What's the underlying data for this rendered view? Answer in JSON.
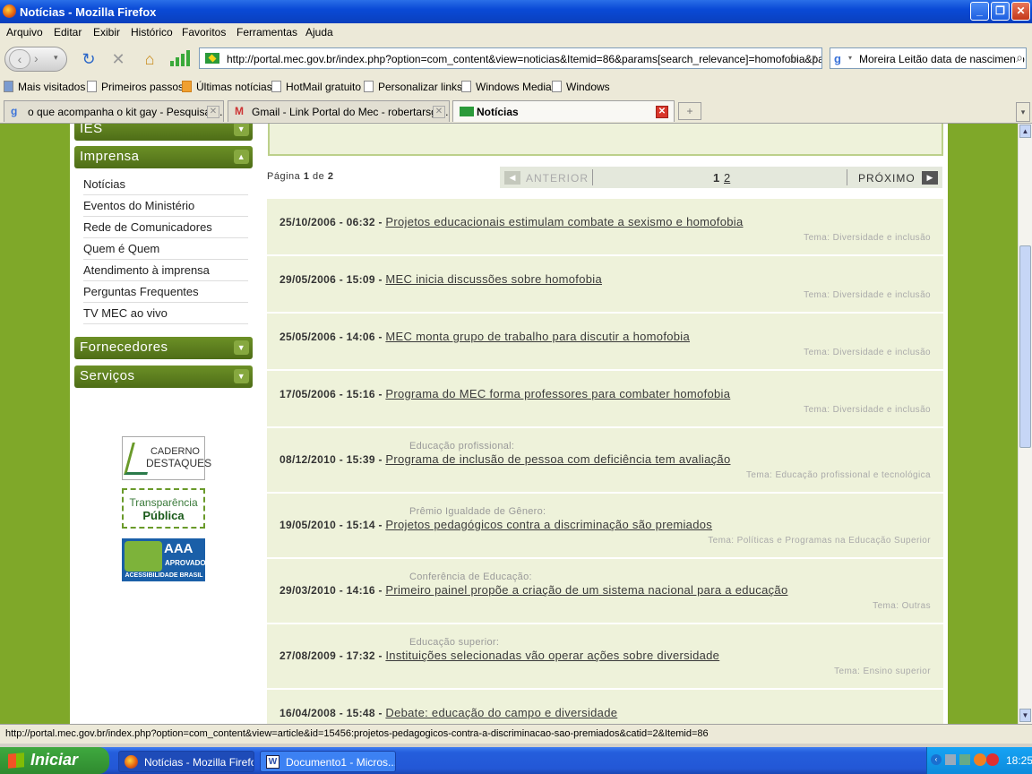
{
  "window": {
    "title": "Notícias - Mozilla Firefox"
  },
  "menu": [
    "Arquivo",
    "Editar",
    "Exibir",
    "Histórico",
    "Favoritos",
    "Ferramentas",
    "Ajuda"
  ],
  "nav": {
    "url": "http://portal.mec.gov.br/index.php?option=com_content&view=noticias&Itemid=86&params[search_relevance]=homofobia&par",
    "search": "Moreira Leitão data de nascimento"
  },
  "bookmarks": [
    "Mais visitados",
    "Primeiros passos",
    "Últimas notícias",
    "HotMail gratuito",
    "Personalizar links",
    "Windows Media",
    "Windows"
  ],
  "tabs": [
    "o que acompanha o kit gay - Pesquisa ...",
    "Gmail - Link Portal do Mec - robertarsgc...",
    "Notícias"
  ],
  "sidebar": {
    "ies": "IES",
    "imprensa": "Imprensa",
    "items": [
      "Notícias",
      "Eventos do Ministério",
      "Rede de Comunicadores",
      "Quem é Quem",
      "Atendimento à imprensa",
      "Perguntas Frequentes",
      "TV MEC ao vivo"
    ],
    "fornecedores": "Fornecedores",
    "servicos": "Serviços",
    "logos": {
      "caderno1": "CADERNO",
      "caderno2": "DESTAQUES",
      "transp1": "Transparência",
      "transp2": "Pública",
      "aaa1": "AAA",
      "aaa2": "APROVADO",
      "aaa3": "ACESSIBILIDADE BRASIL"
    }
  },
  "pager": {
    "pagina": "Página",
    "current": "1",
    "de": "de",
    "total": "2",
    "anterior": "ANTERIOR",
    "p1": "1",
    "p2": "2",
    "proximo": "PRÓXIMO"
  },
  "news": [
    {
      "date": "25/10/2006 - 06:32 -",
      "title": "Projetos educacionais estimulam combate a sexismo e homofobia",
      "cat": "",
      "tema": "Tema: Diversidade e inclusão"
    },
    {
      "date": "29/05/2006 - 15:09 -",
      "title": "MEC inicia discussões sobre homofobia",
      "cat": "",
      "tema": "Tema: Diversidade e inclusão"
    },
    {
      "date": "25/05/2006 - 14:06 -",
      "title": "MEC monta grupo de trabalho para discutir a homofobia",
      "cat": "",
      "tema": "Tema: Diversidade e inclusão"
    },
    {
      "date": "17/05/2006 - 15:16 -",
      "title": "Programa do MEC forma professores para combater homofobia",
      "cat": "",
      "tema": "Tema: Diversidade e inclusão"
    },
    {
      "date": "08/12/2010 - 15:39 -",
      "title": "Programa de inclusão de pessoa com deficiência tem avaliação",
      "cat": "Educação profissional:",
      "tema": "Tema: Educação profissional e tecnológica"
    },
    {
      "date": "19/05/2010 - 15:14 -",
      "title": "Projetos pedagógicos contra a discriminação são premiados",
      "cat": "Prêmio Igualdade de Gênero:",
      "tema": "Tema: Políticas e Programas na Educação Superior"
    },
    {
      "date": "29/03/2010 - 14:16 -",
      "title": "Primeiro painel propõe a criação de um sistema nacional para a educação",
      "cat": "Conferência de Educação:",
      "tema": "Tema: Outras"
    },
    {
      "date": "27/08/2009 - 17:32 -",
      "title": "Instituições selecionadas vão operar ações sobre diversidade",
      "cat": "Educação superior:",
      "tema": "Tema: Ensino superior"
    },
    {
      "date": "16/04/2008 - 15:48 -",
      "title": "Debate: educação do campo e diversidade",
      "cat": "",
      "tema": ""
    }
  ],
  "status": "http://portal.mec.gov.br/index.php?option=com_content&view=article&id=15456:projetos-pedagogicos-contra-a-discriminacao-sao-premiados&catid=2&Itemid=86",
  "taskbar": {
    "start": "Iniciar",
    "items": [
      "Notícias - Mozilla Firefox",
      "Documento1 - Micros..."
    ],
    "clock": "18:25"
  }
}
